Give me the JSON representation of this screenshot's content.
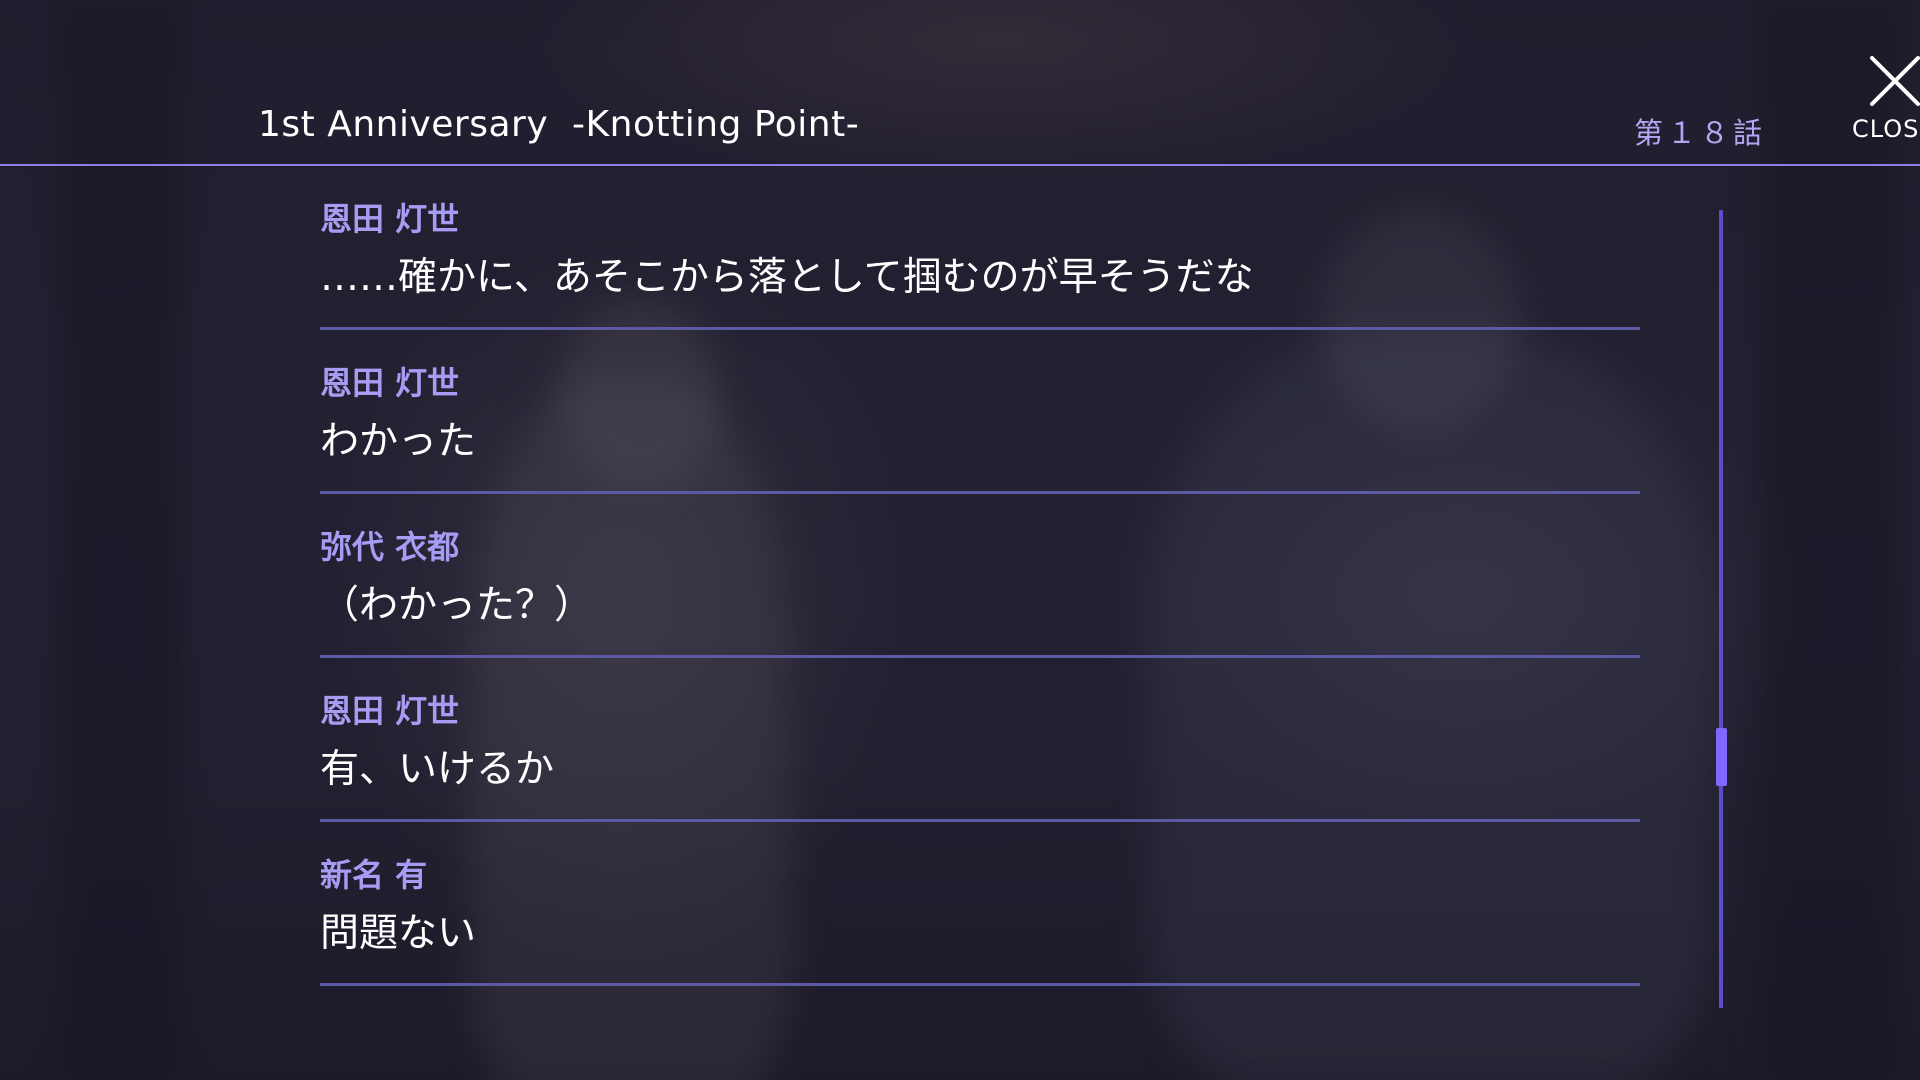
{
  "header": {
    "title": "1st Anniversary  -Knotting Point-",
    "episode": "第１８話",
    "close_label": "CLOS"
  },
  "log": [
    {
      "speaker": "恩田 灯世",
      "text": "……確かに、あそこから落として掴むのが早そうだな"
    },
    {
      "speaker": "恩田 灯世",
      "text": "わかった"
    },
    {
      "speaker": "弥代 衣都",
      "text": "（わかった？）"
    },
    {
      "speaker": "恩田 灯世",
      "text": "有、いけるか"
    },
    {
      "speaker": "新名 有",
      "text": "問題ない"
    }
  ],
  "scrollbar": {
    "position_fraction": 0.7
  },
  "colors": {
    "accent": "#8f7de8",
    "speaker": "#a79cf3",
    "thumb": "#7f67ff"
  },
  "icons": {
    "close": "close-icon"
  }
}
